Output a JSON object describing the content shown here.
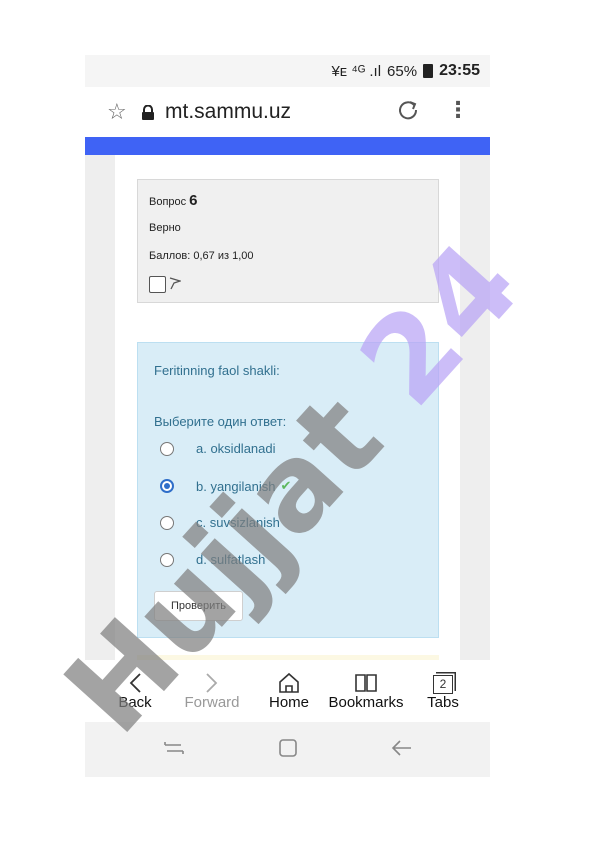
{
  "status_bar": {
    "signal_info": "¥ᴇ ⁴ᴳ .ıl",
    "battery": "65%",
    "battery_icon": "battery-icon",
    "time": "23:55"
  },
  "browser": {
    "url": "mt.sammu.uz",
    "bookmark_icon": "star-icon",
    "lock_icon": "lock-icon",
    "reload_icon": "reload-icon",
    "menu_icon": "more-vertical-icon"
  },
  "question_info": {
    "question_label": "Вопрос",
    "question_number": "6",
    "status": "Верно",
    "grade": "Баллов: 0,67 из 1,00"
  },
  "question": {
    "text": "Feritinning faol shakli:",
    "prompt": "Выберите один ответ:",
    "answers": [
      {
        "label": "a. oksidlanadi",
        "selected": false
      },
      {
        "label": "b. yangilanish",
        "selected": true,
        "correct_mark": "✔"
      },
      {
        "label": "c. suvsizlanish",
        "selected": false
      },
      {
        "label": "d. sulfatlash",
        "selected": false
      }
    ],
    "check_button": "Проверить"
  },
  "toolbar": {
    "back": "Back",
    "forward": "Forward",
    "home": "Home",
    "bookmarks": "Bookmarks",
    "tabs": "Tabs",
    "tabs_count": "2"
  },
  "watermark": {
    "text": "Hujjat 24",
    "color_dark": "#7f7f7f",
    "color_purple": "#b9a3f5"
  },
  "colors": {
    "accent_blue": "#3f63f5",
    "question_bg": "#d9edf7",
    "question_text": "#31708f",
    "correct_green": "#5cb85c"
  }
}
